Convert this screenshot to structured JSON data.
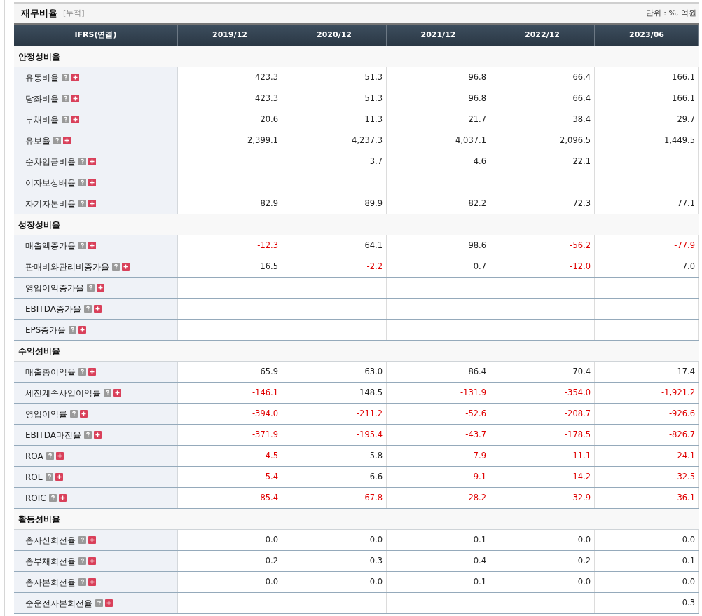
{
  "header": {
    "title": "재무비율",
    "subtitle": "[누적]",
    "unit": "단위 : %, 억원"
  },
  "columns": [
    "IFRS(연결)",
    "2019/12",
    "2020/12",
    "2021/12",
    "2022/12",
    "2023/06"
  ],
  "sections": [
    {
      "title": "안정성비율",
      "rows": [
        {
          "label": "유동비율",
          "cells": [
            {
              "text": "423.3",
              "negative": false
            },
            {
              "text": "51.3",
              "negative": false
            },
            {
              "text": "96.8",
              "negative": false
            },
            {
              "text": "66.4",
              "negative": false
            },
            {
              "text": "166.1",
              "negative": false
            }
          ]
        },
        {
          "label": "당좌비율",
          "cells": [
            {
              "text": "423.3",
              "negative": false
            },
            {
              "text": "51.3",
              "negative": false
            },
            {
              "text": "96.8",
              "negative": false
            },
            {
              "text": "66.4",
              "negative": false
            },
            {
              "text": "166.1",
              "negative": false
            }
          ]
        },
        {
          "label": "부채비율",
          "cells": [
            {
              "text": "20.6",
              "negative": false
            },
            {
              "text": "11.3",
              "negative": false
            },
            {
              "text": "21.7",
              "negative": false
            },
            {
              "text": "38.4",
              "negative": false
            },
            {
              "text": "29.7",
              "negative": false
            }
          ]
        },
        {
          "label": "유보율",
          "cells": [
            {
              "text": "2,399.1",
              "negative": false
            },
            {
              "text": "4,237.3",
              "negative": false
            },
            {
              "text": "4,037.1",
              "negative": false
            },
            {
              "text": "2,096.5",
              "negative": false
            },
            {
              "text": "1,449.5",
              "negative": false
            }
          ]
        },
        {
          "label": "순차입금비율",
          "cells": [
            null,
            {
              "text": "3.7",
              "negative": false
            },
            {
              "text": "4.6",
              "negative": false
            },
            {
              "text": "22.1",
              "negative": false
            },
            null
          ]
        },
        {
          "label": "이자보상배율",
          "cells": [
            null,
            null,
            null,
            null,
            null
          ]
        },
        {
          "label": "자기자본비율",
          "cells": [
            {
              "text": "82.9",
              "negative": false
            },
            {
              "text": "89.9",
              "negative": false
            },
            {
              "text": "82.2",
              "negative": false
            },
            {
              "text": "72.3",
              "negative": false
            },
            {
              "text": "77.1",
              "negative": false
            }
          ]
        }
      ]
    },
    {
      "title": "성장성비율",
      "rows": [
        {
          "label": "매출액증가율",
          "cells": [
            {
              "text": "-12.3",
              "negative": true
            },
            {
              "text": "64.1",
              "negative": false
            },
            {
              "text": "98.6",
              "negative": false
            },
            {
              "text": "-56.2",
              "negative": true
            },
            {
              "text": "-77.9",
              "negative": true
            }
          ]
        },
        {
          "label": "판매비와관리비증가율",
          "cells": [
            {
              "text": "16.5",
              "negative": false
            },
            {
              "text": "-2.2",
              "negative": true
            },
            {
              "text": "0.7",
              "negative": false
            },
            {
              "text": "-12.0",
              "negative": true
            },
            {
              "text": "7.0",
              "negative": false
            }
          ]
        },
        {
          "label": "영업이익증가율",
          "cells": [
            null,
            null,
            null,
            null,
            null
          ]
        },
        {
          "label": "EBITDA증가율",
          "cells": [
            null,
            null,
            null,
            null,
            null
          ]
        },
        {
          "label": "EPS증가율",
          "cells": [
            null,
            null,
            null,
            null,
            null
          ]
        }
      ]
    },
    {
      "title": "수익성비율",
      "rows": [
        {
          "label": "매출총이익율",
          "cells": [
            {
              "text": "65.9",
              "negative": false
            },
            {
              "text": "63.0",
              "negative": false
            },
            {
              "text": "86.4",
              "negative": false
            },
            {
              "text": "70.4",
              "negative": false
            },
            {
              "text": "17.4",
              "negative": false
            }
          ]
        },
        {
          "label": "세전계속사업이익률",
          "cells": [
            {
              "text": "-146.1",
              "negative": true
            },
            {
              "text": "148.5",
              "negative": false
            },
            {
              "text": "-131.9",
              "negative": true
            },
            {
              "text": "-354.0",
              "negative": true
            },
            {
              "text": "-1,921.2",
              "negative": true
            }
          ]
        },
        {
          "label": "영업이익률",
          "cells": [
            {
              "text": "-394.0",
              "negative": true
            },
            {
              "text": "-211.2",
              "negative": true
            },
            {
              "text": "-52.6",
              "negative": true
            },
            {
              "text": "-208.7",
              "negative": true
            },
            {
              "text": "-926.6",
              "negative": true
            }
          ]
        },
        {
          "label": "EBITDA마진율",
          "cells": [
            {
              "text": "-371.9",
              "negative": true
            },
            {
              "text": "-195.4",
              "negative": true
            },
            {
              "text": "-43.7",
              "negative": true
            },
            {
              "text": "-178.5",
              "negative": true
            },
            {
              "text": "-826.7",
              "negative": true
            }
          ]
        },
        {
          "label": "ROA",
          "cells": [
            {
              "text": "-4.5",
              "negative": true
            },
            {
              "text": "5.8",
              "negative": false
            },
            {
              "text": "-7.9",
              "negative": true
            },
            {
              "text": "-11.1",
              "negative": true
            },
            {
              "text": "-24.1",
              "negative": true
            }
          ]
        },
        {
          "label": "ROE",
          "cells": [
            {
              "text": "-5.4",
              "negative": true
            },
            {
              "text": "6.6",
              "negative": false
            },
            {
              "text": "-9.1",
              "negative": true
            },
            {
              "text": "-14.2",
              "negative": true
            },
            {
              "text": "-32.5",
              "negative": true
            }
          ]
        },
        {
          "label": "ROIC",
          "cells": [
            {
              "text": "-85.4",
              "negative": true
            },
            {
              "text": "-67.8",
              "negative": true
            },
            {
              "text": "-28.2",
              "negative": true
            },
            {
              "text": "-32.9",
              "negative": true
            },
            {
              "text": "-36.1",
              "negative": true
            }
          ]
        }
      ]
    },
    {
      "title": "활동성비율",
      "rows": [
        {
          "label": "총자산회전율",
          "cells": [
            {
              "text": "0.0",
              "negative": false
            },
            {
              "text": "0.0",
              "negative": false
            },
            {
              "text": "0.1",
              "negative": false
            },
            {
              "text": "0.0",
              "negative": false
            },
            {
              "text": "0.0",
              "negative": false
            }
          ]
        },
        {
          "label": "총부채회전율",
          "cells": [
            {
              "text": "0.2",
              "negative": false
            },
            {
              "text": "0.3",
              "negative": false
            },
            {
              "text": "0.4",
              "negative": false
            },
            {
              "text": "0.2",
              "negative": false
            },
            {
              "text": "0.1",
              "negative": false
            }
          ]
        },
        {
          "label": "총자본회전율",
          "cells": [
            {
              "text": "0.0",
              "negative": false
            },
            {
              "text": "0.0",
              "negative": false
            },
            {
              "text": "0.1",
              "negative": false
            },
            {
              "text": "0.0",
              "negative": false
            },
            {
              "text": "0.0",
              "negative": false
            }
          ]
        },
        {
          "label": "순운전자본회전율",
          "cells": [
            null,
            null,
            null,
            null,
            {
              "text": "0.3",
              "negative": false
            }
          ]
        }
      ]
    }
  ]
}
